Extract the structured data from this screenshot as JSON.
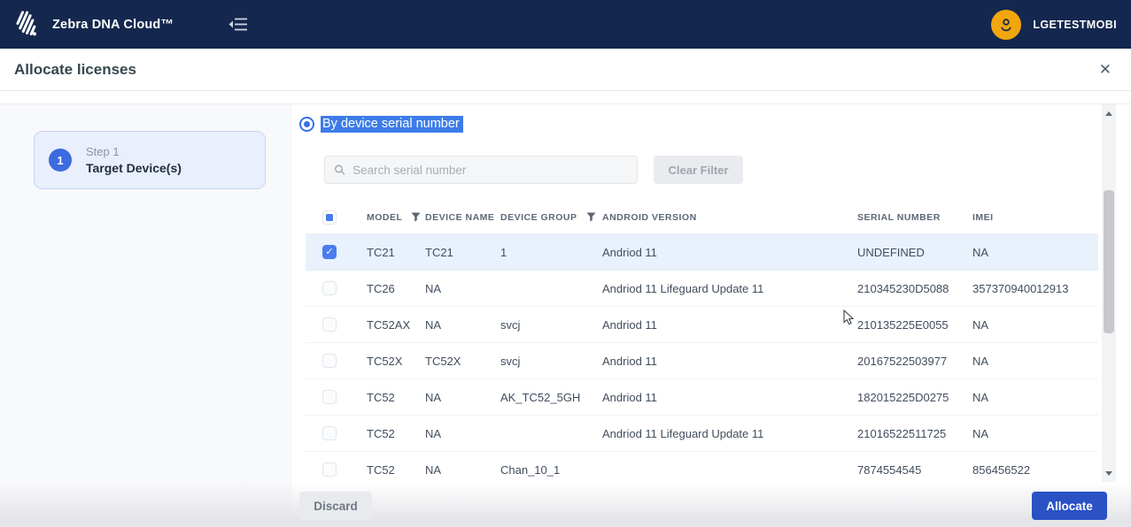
{
  "navbar": {
    "brand": "Zebra DNA Cloud™",
    "username": "LGETESTMOBI"
  },
  "page": {
    "title": "Allocate licenses",
    "close_glyph": "✕"
  },
  "wizard": {
    "step_number": "1",
    "step_label": "Step 1",
    "step_title": "Target Device(s)"
  },
  "filters": {
    "radio_label": "By device serial number",
    "search_placeholder": "Search serial number",
    "search_value": "",
    "clear_button": "Clear Filter"
  },
  "table": {
    "headers": [
      "MODEL",
      "DEVICE NAME",
      "DEVICE GROUP",
      "ANDROID VERSION",
      "SERIAL NUMBER",
      "IMEI"
    ],
    "header_checkbox_state": "indeterminate",
    "rows": [
      {
        "checked": true,
        "model": "TC21",
        "device_name": "TC21",
        "device_group": "1",
        "android_version": "Andriod 11",
        "serial": "UNDEFINED",
        "imei": "NA"
      },
      {
        "checked": false,
        "model": "TC26",
        "device_name": "NA",
        "device_group": "",
        "android_version": "Andriod 11 Lifeguard Update 11",
        "serial": "210345230D5088",
        "imei": "357370940012913"
      },
      {
        "checked": false,
        "model": "TC52AX",
        "device_name": "NA",
        "device_group": "svcj",
        "android_version": "Andriod 11",
        "serial": "210135225E0055",
        "imei": "NA"
      },
      {
        "checked": false,
        "model": "TC52X",
        "device_name": "TC52X",
        "device_group": "svcj",
        "android_version": "Andriod 11",
        "serial": "20167522503977",
        "imei": "NA"
      },
      {
        "checked": false,
        "model": "TC52",
        "device_name": "NA",
        "device_group": "AK_TC52_5GH",
        "android_version": "Andriod 11",
        "serial": "182015225D0275",
        "imei": "NA"
      },
      {
        "checked": false,
        "model": "TC52",
        "device_name": "NA",
        "device_group": "",
        "android_version": "Andriod 11 Lifeguard Update 11",
        "serial": "21016522511725",
        "imei": "NA"
      },
      {
        "checked": false,
        "model": "TC52",
        "device_name": "NA",
        "device_group": "Chan_10_1",
        "android_version": "",
        "serial": "7874554545",
        "imei": "856456522"
      }
    ]
  },
  "footer": {
    "discard": "Discard",
    "allocate": "Allocate"
  },
  "colors": {
    "navbar_bg": "#14274e",
    "accent_blue": "#2a52c4",
    "checkbox_blue": "#4a7bf0",
    "avatar_amber": "#f2a60d",
    "selected_row_bg": "#e9f1fc",
    "selection_highlight": "#3d7ce8"
  }
}
